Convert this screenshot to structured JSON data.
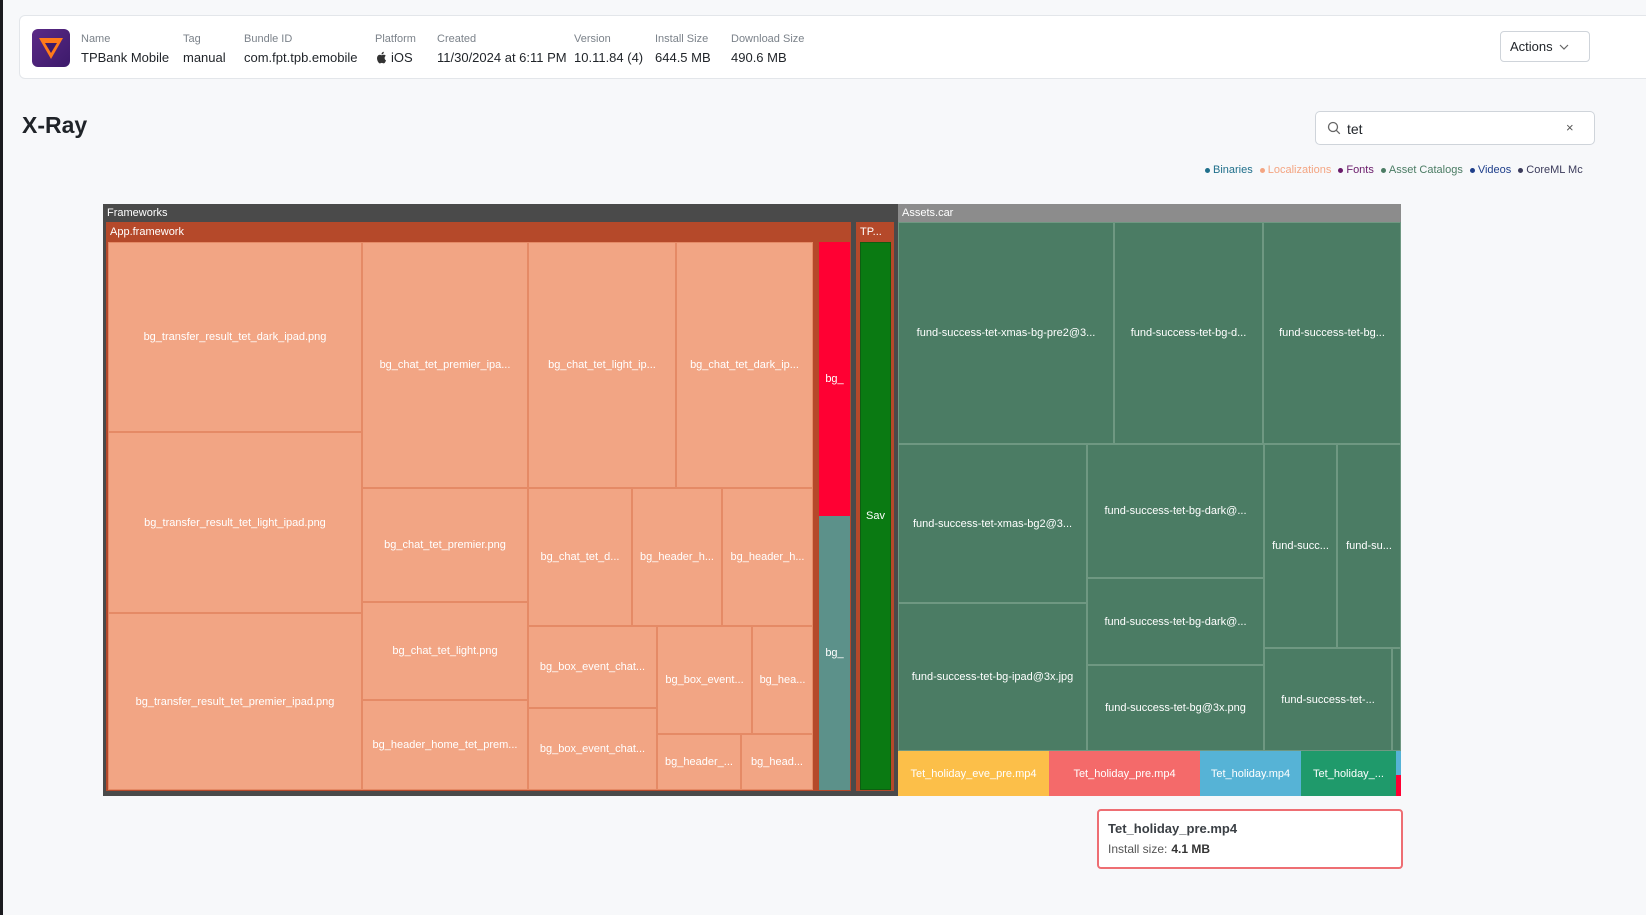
{
  "app": {
    "fields": [
      {
        "label": "Name",
        "value": "TPBank Mobile"
      },
      {
        "label": "Tag",
        "value": "manual"
      },
      {
        "label": "Bundle ID",
        "value": "com.fpt.tpb.emobile"
      },
      {
        "label": "Platform",
        "value": "iOS"
      },
      {
        "label": "Created",
        "value": "11/30/2024 at 6:11 PM"
      },
      {
        "label": "Version",
        "value": "10.11.84 (4)"
      },
      {
        "label": "Install Size",
        "value": "644.5 MB"
      },
      {
        "label": "Download Size",
        "value": "490.6 MB"
      }
    ],
    "actions_label": "Actions"
  },
  "page": {
    "title": "X-Ray"
  },
  "search": {
    "value": "tet",
    "clear": "×"
  },
  "legend": [
    {
      "label": "Binaries",
      "color": "#1f6f8b"
    },
    {
      "label": "Localizations",
      "color": "#f4a582"
    },
    {
      "label": "Fonts",
      "color": "#6a1b6a"
    },
    {
      "label": "Asset Catalogs",
      "color": "#4b7c64"
    },
    {
      "label": "Videos",
      "color": "#1f3f8b"
    },
    {
      "label": "CoreML Mc",
      "color": "#3b3b5b"
    }
  ],
  "treemap": {
    "frameworks": "Frameworks",
    "app_framework": "App.framework",
    "tp_header": "TP...",
    "assets_car": "Assets.car",
    "app_cells": [
      "bg_transfer_result_tet_dark_ipad.png",
      "bg_transfer_result_tet_light_ipad.png",
      "bg_transfer_result_tet_premier_ipad.png",
      "bg_chat_tet_premier_ipa...",
      "bg_chat_tet_light_ip...",
      "bg_chat_tet_dark_ip...",
      "bg_chat_tet_premier.png",
      "bg_chat_tet_light.png",
      "bg_header_home_tet_prem...",
      "bg_chat_tet_d...",
      "bg_header_h...",
      "bg_header_h...",
      "bg_box_event_chat...",
      "bg_box_event_chat...",
      "bg_box_event...",
      "bg_hea...",
      "bg_header_...",
      "bg_head..."
    ],
    "narrow_cells": [
      "bg_",
      "bg_"
    ],
    "tp_cell": "Sav",
    "asset_cells": [
      "fund-success-tet-xmas-bg-pre2@3...",
      "fund-success-tet-bg-d...",
      "fund-success-tet-bg...",
      "fund-success-tet-xmas-bg2@3...",
      "fund-success-tet-bg-dark@...",
      "fund-success-tet-bg-dark@...",
      "fund-success-tet-bg-ipad@3x.jpg",
      "fund-success-tet-bg@3x.png",
      "fund-succ...",
      "fund-su...",
      "fund-success-tet-..."
    ],
    "video_cells": [
      {
        "label": "Tet_holiday_eve_pre.mp4",
        "color": "#fcbf49"
      },
      {
        "label": "Tet_holiday_pre.mp4",
        "color": "#f46a6a"
      },
      {
        "label": "Tet_holiday.mp4",
        "color": "#56b3d6"
      },
      {
        "label": "Tet_holiday_...",
        "color": "#1f9a6b"
      }
    ]
  },
  "tooltip": {
    "name": "Tet_holiday_pre.mp4",
    "size_label": "Install size:",
    "size_value": "4.1 MB"
  }
}
